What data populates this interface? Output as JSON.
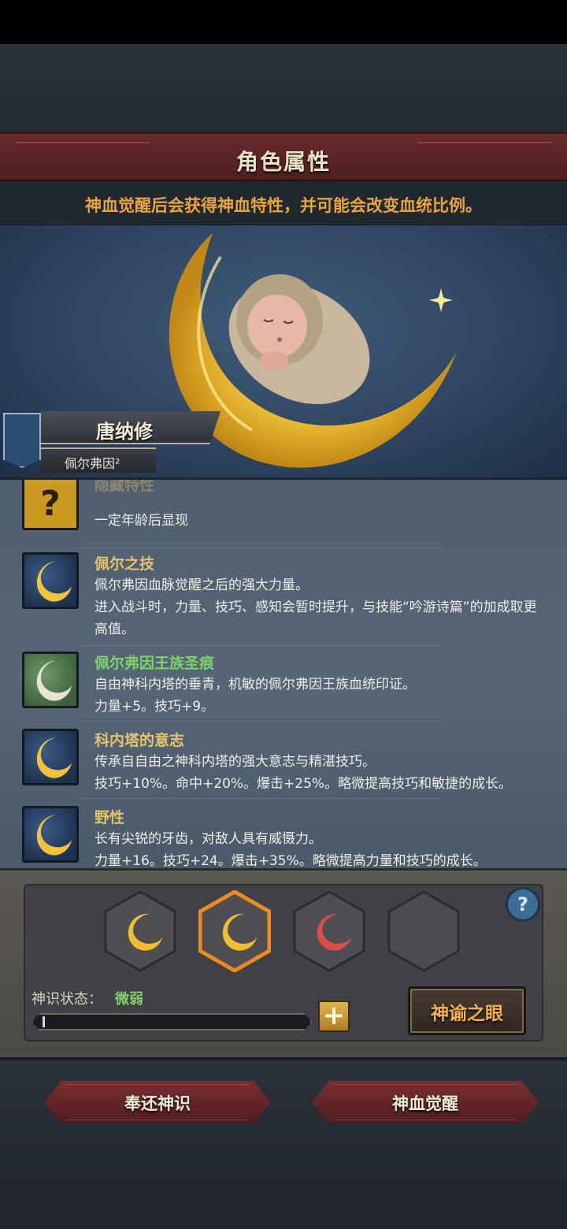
{
  "header": {
    "title": "角色属性",
    "hint": "神血觉醒后会获得神血特性，并可能会改变血统比例。"
  },
  "character": {
    "name": "唐纳修",
    "lineage": "佩尔弗因²"
  },
  "traits": [
    {
      "title": "隐藏特性",
      "desc": "一定年龄后显现",
      "icon": "question-icon",
      "color": "gold"
    },
    {
      "title": "佩尔之技",
      "desc": "佩尔弗因血脉觉醒之后的强大力量。\n进入战斗时，力量、技巧、感知会暂时提升，与技能“吟游诗篇”的加成取更高值。",
      "icon": "crescent-moon-icon",
      "color": "gold"
    },
    {
      "title": "佩尔弗因王族圣痕",
      "desc": "自由神科内塔的垂青，机敏的佩尔弗因王族血统印证。\n力量+5。技巧+9。",
      "icon": "crescent-moon-icon",
      "color": "green"
    },
    {
      "title": "科内塔的意志",
      "desc": "传承自自由之神科内塔的强大意志与精湛技巧。\n技巧+10%。命中+20%。爆击+25%。略微提高技巧和敏捷的成长。",
      "icon": "crescent-moon-icon",
      "color": "gold"
    },
    {
      "title": "野性",
      "desc": "长有尖锐的牙齿，对敌人具有威慑力。\n力量+16。技巧+24。爆击+35%。略微提高力量和技巧的成长。",
      "icon": "crescent-moon-icon",
      "color": "gold"
    }
  ],
  "divine": {
    "status_label": "神识状态：",
    "status_value": "微弱",
    "progress": 0.01,
    "help": "?",
    "plus": "+",
    "oracle_button": "神谕之眼",
    "slots": [
      "gold",
      "gold-selected",
      "red",
      "empty"
    ]
  },
  "footer": {
    "return_button": "奉还神识",
    "awaken_button": "神血觉醒"
  },
  "colors": {
    "accent_gold": "#e7a33f",
    "trait_gold": "#e5c36a",
    "trait_green": "#7fd06a",
    "banner_red": "#6b2a2c"
  }
}
